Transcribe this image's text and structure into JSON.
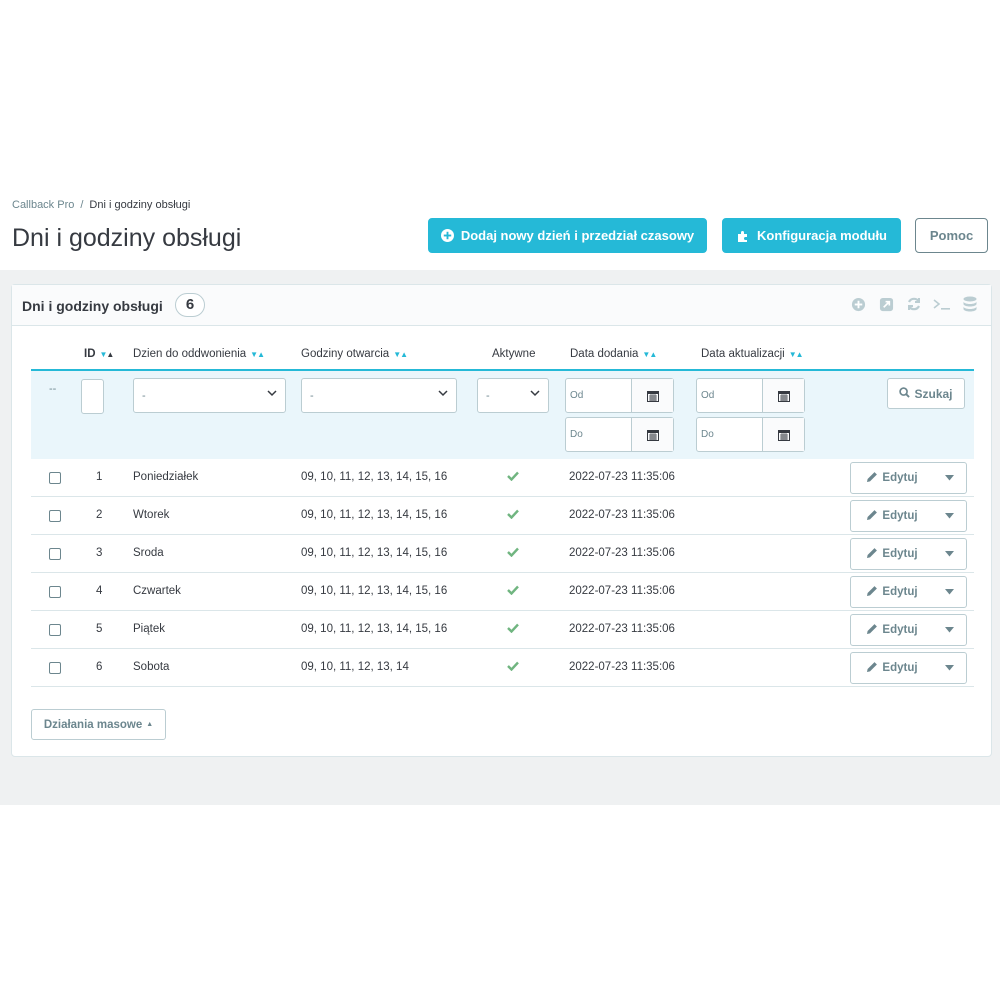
{
  "breadcrumb": {
    "parent": "Callback Pro",
    "separator": "/",
    "current": "Dni i godziny obsługi"
  },
  "page_title": "Dni i godziny obsługi",
  "toolbar": {
    "add_label": "Dodaj nowy dzień i przedział czasowy",
    "config_label": "Konfiguracja modułu",
    "help_label": "Pomoc"
  },
  "panel": {
    "title": "Dni i godziny obsługi",
    "count": "6"
  },
  "columns": {
    "id": "ID",
    "day": "Dzien do oddwonienia",
    "hours": "Godziny otwarcia",
    "active": "Aktywne",
    "date_added": "Data dodania",
    "date_updated": "Data aktualizacji"
  },
  "filters": {
    "dash": "--",
    "day_select": "-",
    "hours_select": "-",
    "active_select": "-",
    "from_placeholder": "Od",
    "to_placeholder": "Do",
    "search_label": "Szukaj"
  },
  "rows": [
    {
      "id": "1",
      "day": "Poniedziałek",
      "hours": "09, 10, 11, 12, 13, 14, 15, 16",
      "active": true,
      "date_added": "2022-07-23 11:35:06",
      "date_updated": ""
    },
    {
      "id": "2",
      "day": "Wtorek",
      "hours": "09, 10, 11, 12, 13, 14, 15, 16",
      "active": true,
      "date_added": "2022-07-23 11:35:06",
      "date_updated": ""
    },
    {
      "id": "3",
      "day": "Sroda",
      "hours": "09, 10, 11, 12, 13, 14, 15, 16",
      "active": true,
      "date_added": "2022-07-23 11:35:06",
      "date_updated": ""
    },
    {
      "id": "4",
      "day": "Czwartek",
      "hours": "09, 10, 11, 12, 13, 14, 15, 16",
      "active": true,
      "date_added": "2022-07-23 11:35:06",
      "date_updated": ""
    },
    {
      "id": "5",
      "day": "Piątek",
      "hours": "09, 10, 11, 12, 13, 14, 15, 16",
      "active": true,
      "date_added": "2022-07-23 11:35:06",
      "date_updated": ""
    },
    {
      "id": "6",
      "day": "Sobota",
      "hours": "09, 10, 11, 12, 13, 14",
      "active": true,
      "date_added": "2022-07-23 11:35:06",
      "date_updated": ""
    }
  ],
  "row_actions": {
    "edit_label": "Edytuj"
  },
  "bulk_label": "Działania masowe",
  "colors": {
    "accent": "#25b9d7",
    "success": "#70b580",
    "text": "#363a41",
    "muted": "#6c868e"
  }
}
